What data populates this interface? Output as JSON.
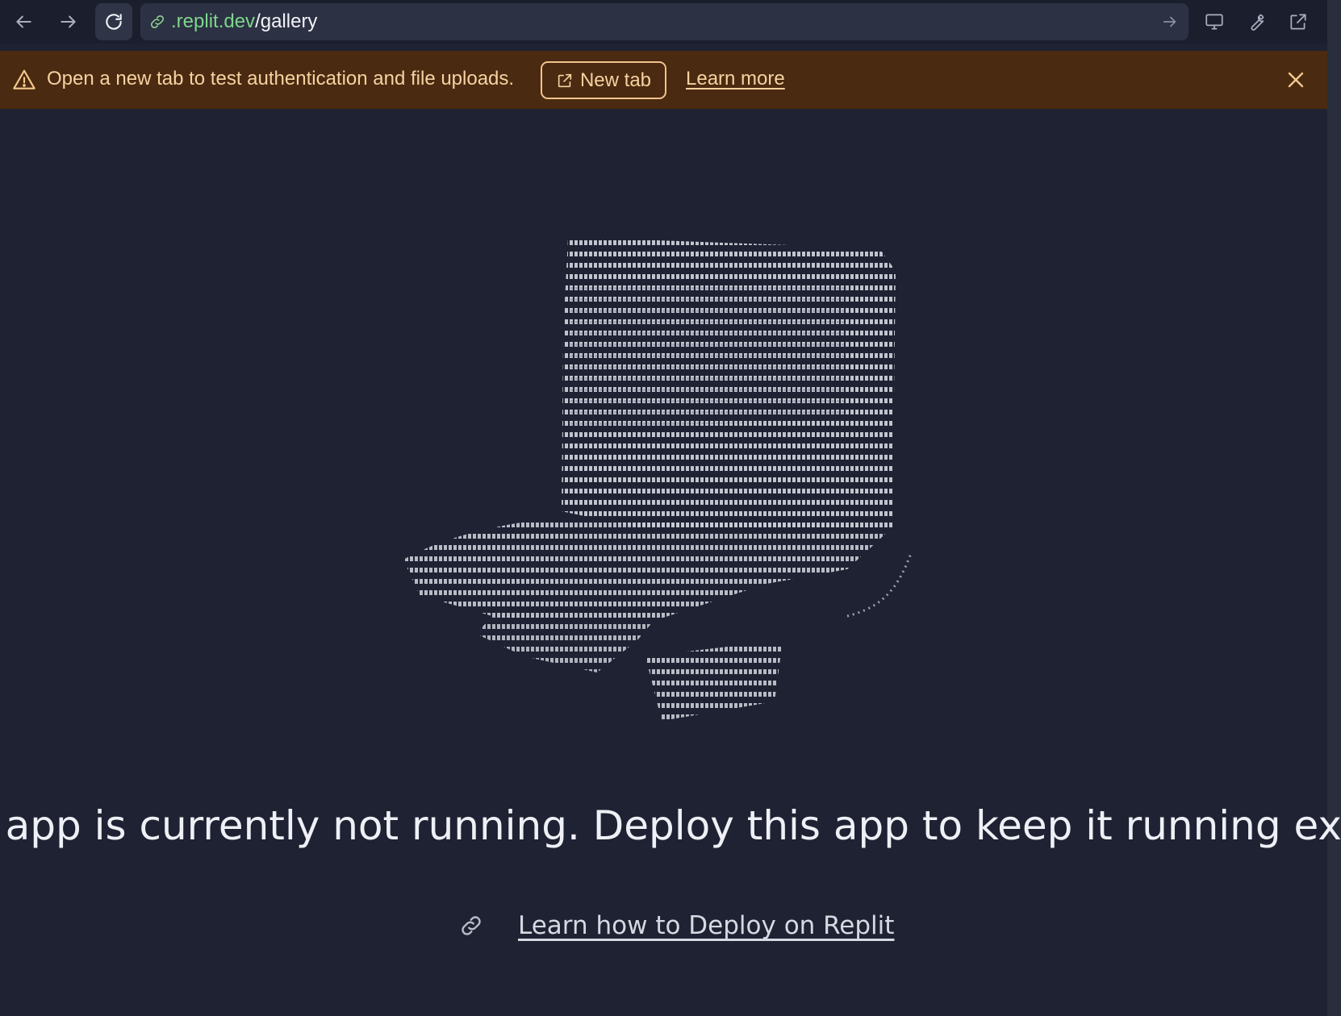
{
  "browser": {
    "url_domain": ".replit.dev",
    "url_path": "/gallery",
    "icons": [
      "back-arrow-icon",
      "forward-arrow-icon",
      "reload-icon",
      "link-icon",
      "go-arrow-icon",
      "monitor-icon",
      "wrench-icon",
      "external-link-icon"
    ]
  },
  "banner": {
    "text": "Open a new tab to test authentication and file uploads.",
    "new_tab_label": "New tab",
    "learn_more_label": "Learn more",
    "colors": {
      "background": "#4a2a10",
      "text": "#f6d2a2"
    }
  },
  "main": {
    "message": "e app is currently not running. Deploy this app to keep it running externa",
    "deploy_link_label": "Learn how to Deploy on Replit",
    "illustration": "ascii-art-top-hat"
  },
  "colors": {
    "page_background": "#1e2232",
    "toolbar_background": "#1b1f2d",
    "url_domain": "#7ed58d",
    "text": "#eef0f6"
  }
}
